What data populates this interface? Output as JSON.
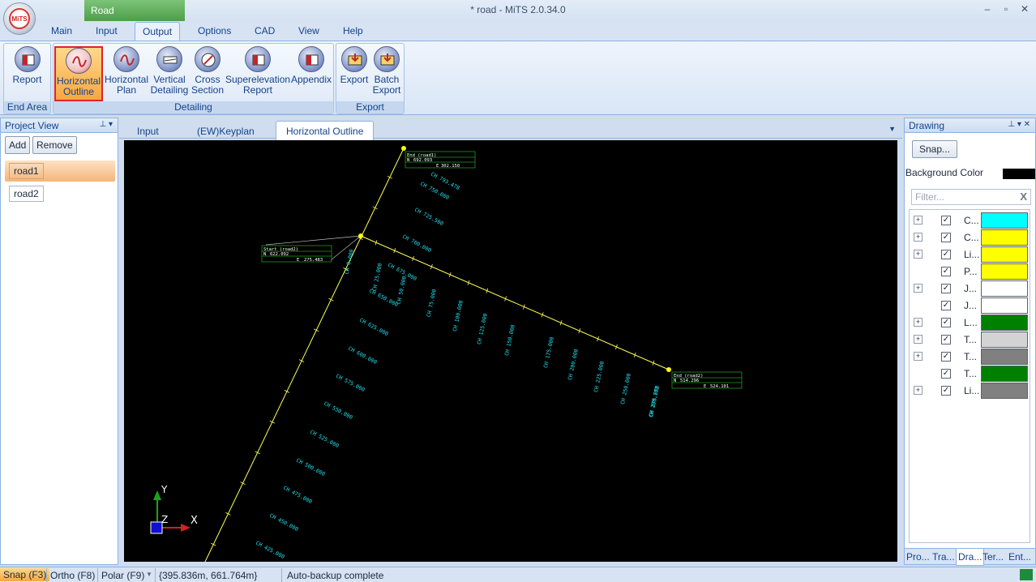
{
  "app": {
    "title": "* road - MiTS 2.0.34.0",
    "context_tab": "Road",
    "logo_text": "MiTS"
  },
  "window_controls": [
    "–",
    "▫",
    "✕"
  ],
  "menu": {
    "tabs": [
      "Main",
      "Input",
      "Output",
      "Options",
      "CAD",
      "View",
      "Help"
    ],
    "active": "Output"
  },
  "ribbon": {
    "groups": [
      {
        "label": "End Area",
        "buttons": [
          {
            "line1": "Report",
            "line2": ""
          }
        ]
      },
      {
        "label": "Detailing",
        "buttons": [
          {
            "line1": "Horizontal",
            "line2": "Outline",
            "selected": true
          },
          {
            "line1": "Horizontal",
            "line2": "Plan"
          },
          {
            "line1": "Vertical",
            "line2": "Detailing"
          },
          {
            "line1": "Cross",
            "line2": "Section"
          },
          {
            "line1": "Superelevation",
            "line2": "Report"
          },
          {
            "line1": "Appendix",
            "line2": ""
          }
        ]
      },
      {
        "label": "Export",
        "buttons": [
          {
            "line1": "Export",
            "line2": ""
          },
          {
            "line1": "Batch",
            "line2": "Export"
          }
        ]
      }
    ]
  },
  "project_view": {
    "title": "Project View",
    "add_label": "Add",
    "remove_label": "Remove",
    "items": [
      "road1",
      "road2"
    ],
    "selected": "road1"
  },
  "documents": {
    "tabs": [
      "Input",
      "(EW)Keyplan",
      "Horizontal Outline"
    ],
    "active": "Horizontal Outline"
  },
  "canvas": {
    "road1_end": {
      "title": "End (road1)",
      "n": "N",
      "n_val": "692.093",
      "e": "E",
      "e_val": "302.150"
    },
    "road2_start": {
      "title": "Start (road2)",
      "n": "N",
      "n_val": "622.092",
      "e": "E",
      "e_val": "275.483"
    },
    "road2_end": {
      "title": "End (road2)",
      "n": "N",
      "n_val": "514.296",
      "e": "E",
      "e_val": "524.101"
    },
    "road1_chainages": [
      "CH 793.478",
      "CH 750.000",
      "CH 725.500",
      "CH 700.000",
      "CH 675.000",
      "CH 650.000",
      "CH 625.000",
      "CH 600.000",
      "CH 575.000",
      "CH 550.000",
      "CH 525.000",
      "CH 500.000",
      "CH 475.000",
      "CH 450.000",
      "CH 425.000"
    ],
    "road2_chainages": [
      "CH 0.000",
      "CH 25.000",
      "CH 50.000",
      "CH 75.000",
      "CH 100.000",
      "CH 125.000",
      "CH 150.000",
      "CH 175.000",
      "CH 200.000",
      "CH 225.000",
      "CH 250.000",
      "CH 275.000",
      "CH 288.172"
    ],
    "axis_y": "Y",
    "axis_z": "Z",
    "axis_x": "X"
  },
  "drawing_panel": {
    "title": "Drawing",
    "snap_label": "Snap...",
    "bg_label": "Background Color",
    "bg_color": "#000000",
    "filter_placeholder": "Filter...",
    "layers": [
      {
        "name": "C...",
        "color": "#00ffff",
        "expandable": true
      },
      {
        "name": "C...",
        "color": "#ffff00",
        "expandable": true
      },
      {
        "name": "Li...",
        "color": "#ffff00",
        "expandable": true
      },
      {
        "name": "P...",
        "color": "#ffff00",
        "expandable": false
      },
      {
        "name": "J...",
        "color": "#ffffff",
        "expandable": true
      },
      {
        "name": "J...",
        "color": "#ffffff",
        "expandable": false
      },
      {
        "name": "L...",
        "color": "#008000",
        "expandable": true
      },
      {
        "name": "T...",
        "color": "#d3d3d3",
        "expandable": true
      },
      {
        "name": "T...",
        "color": "#808080",
        "expandable": true
      },
      {
        "name": "T...",
        "color": "#008000",
        "expandable": false
      },
      {
        "name": "Li...",
        "color": "#808080",
        "expandable": true
      }
    ],
    "bottom_tabs": [
      "Pro...",
      "Tra...",
      "Dra...",
      "Ter...",
      "Ent..."
    ],
    "active_tab": "Dra..."
  },
  "status": {
    "snap": "Snap (F3)",
    "ortho": "Ortho (F8)",
    "polar": "Polar (F9)",
    "coords": "{395.836m, 661.764m}",
    "message": "Auto-backup complete"
  }
}
